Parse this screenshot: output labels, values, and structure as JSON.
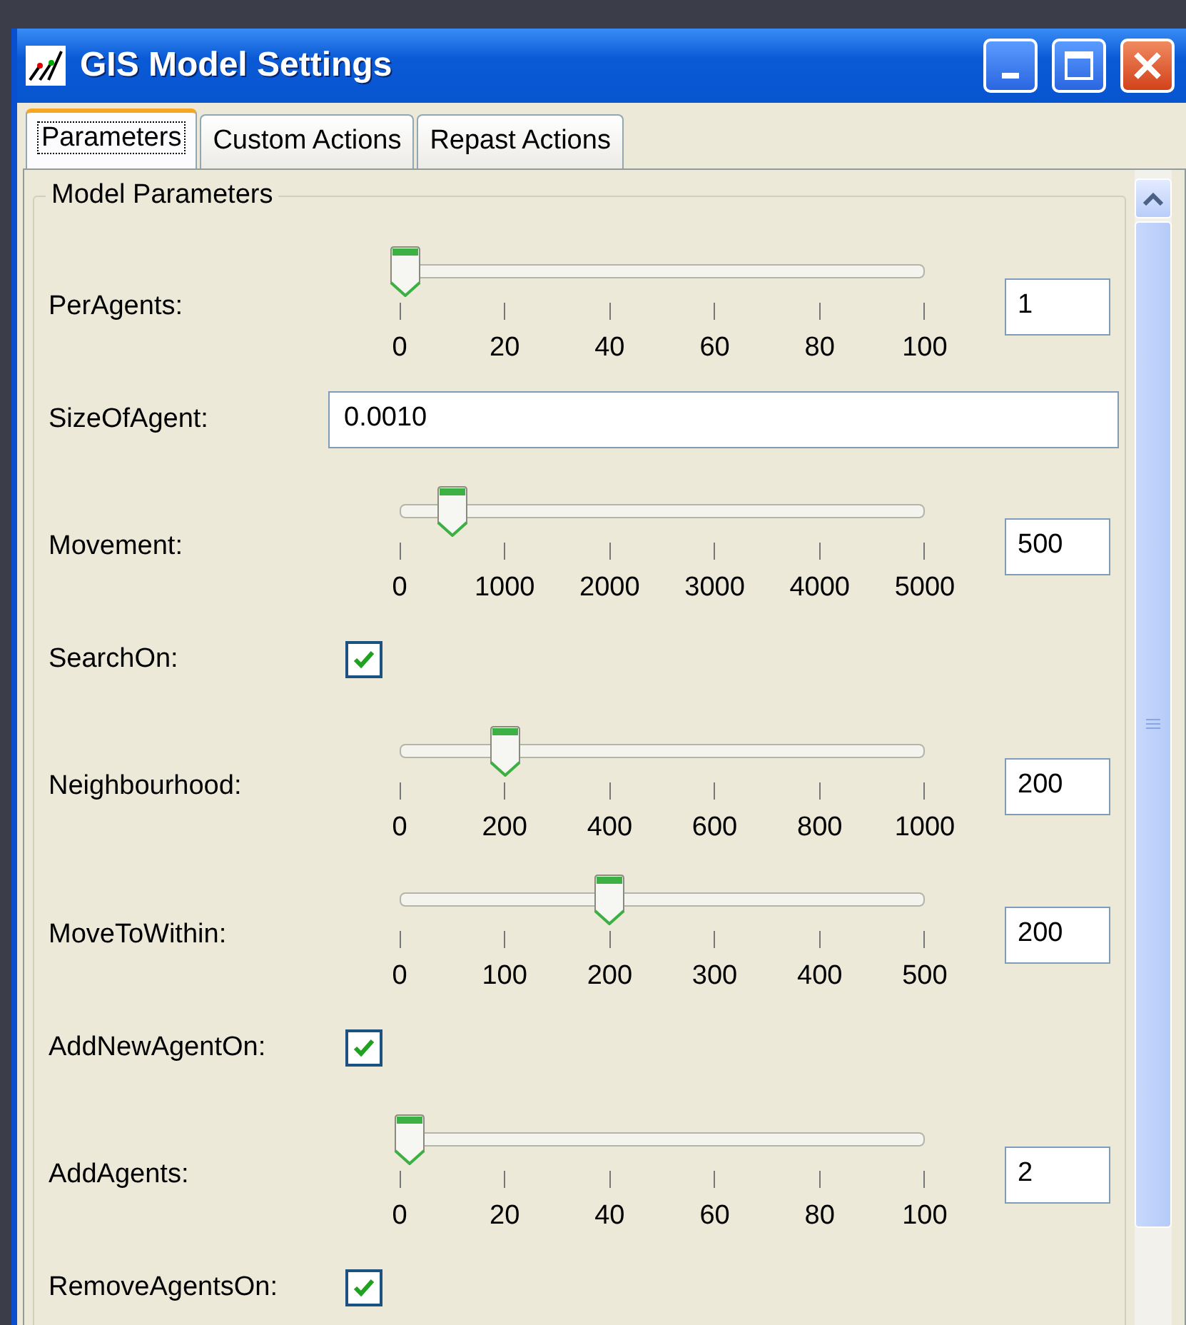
{
  "window": {
    "title": "GIS Model Settings"
  },
  "tabs": [
    {
      "label": "Parameters",
      "selected": true
    },
    {
      "label": "Custom Actions",
      "selected": false
    },
    {
      "label": "Repast Actions",
      "selected": false
    }
  ],
  "group": {
    "title": "Model Parameters"
  },
  "parameters": [
    {
      "kind": "slider",
      "label": "PerAgents:",
      "level": 0.01,
      "ticks": [
        "0",
        "20",
        "40",
        "60",
        "80",
        "100"
      ],
      "value": "1"
    },
    {
      "kind": "text",
      "label": "SizeOfAgent:",
      "value": "0.0010"
    },
    {
      "kind": "slider",
      "label": "Movement:",
      "level": 0.1,
      "ticks": [
        "0",
        "1000",
        "2000",
        "3000",
        "4000",
        "5000"
      ],
      "value": "500"
    },
    {
      "kind": "checkbox",
      "label": "SearchOn:",
      "checked": true
    },
    {
      "kind": "slider",
      "label": "Neighbourhood:",
      "level": 0.2,
      "ticks": [
        "0",
        "200",
        "400",
        "600",
        "800",
        "1000"
      ],
      "value": "200"
    },
    {
      "kind": "slider",
      "label": "MoveToWithin:",
      "level": 0.4,
      "ticks": [
        "0",
        "100",
        "200",
        "300",
        "400",
        "500"
      ],
      "value": "200"
    },
    {
      "kind": "checkbox",
      "label": "AddNewAgentOn:",
      "checked": true
    },
    {
      "kind": "slider",
      "label": "AddAgents:",
      "level": 0.02,
      "ticks": [
        "0",
        "20",
        "40",
        "60",
        "80",
        "100"
      ],
      "value": "2"
    },
    {
      "kind": "checkbox",
      "label": "RemoveAgentsOn:",
      "checked": true
    }
  ]
}
